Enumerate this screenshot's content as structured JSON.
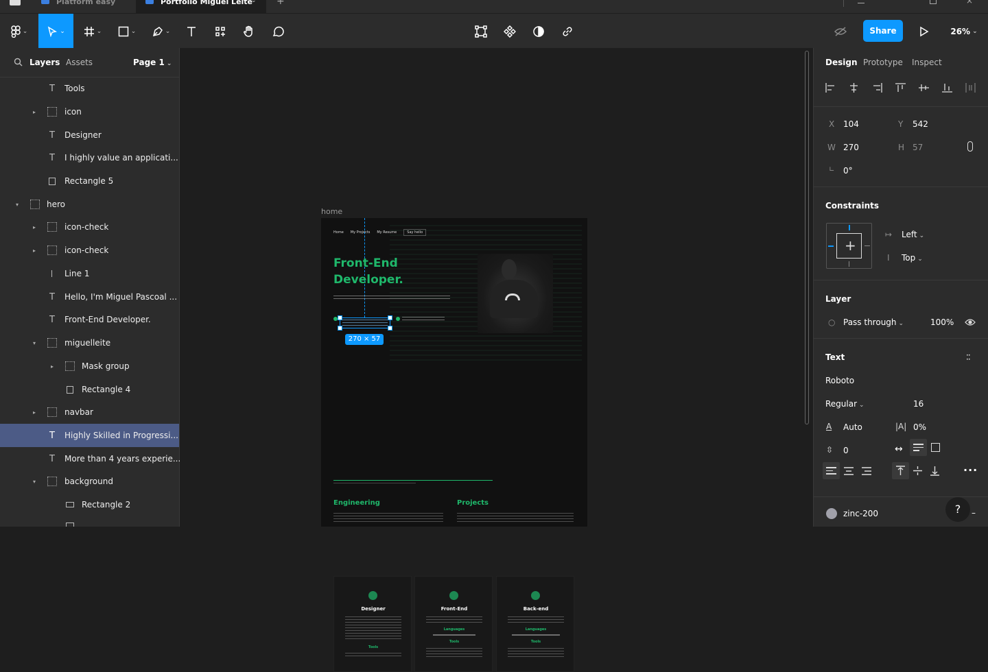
{
  "tabs": [
    {
      "label": "Platform easy",
      "active": false
    },
    {
      "label": "Portfolio Miguel Leite",
      "active": true
    }
  ],
  "toolbar": {
    "share_label": "Share",
    "zoom": "26%"
  },
  "left_panel": {
    "tab_layers": "Layers",
    "tab_assets": "Assets",
    "page": "Page 1",
    "layers": [
      {
        "label": "Tools",
        "type": "text"
      },
      {
        "label": "icon",
        "type": "frame"
      },
      {
        "label": "Designer",
        "type": "text"
      },
      {
        "label": "I highly value an applicati...",
        "type": "text"
      },
      {
        "label": "Rectangle 5",
        "type": "rect"
      },
      {
        "label": "hero",
        "type": "frame"
      },
      {
        "label": "icon-check",
        "type": "frame"
      },
      {
        "label": "icon-check",
        "type": "frame"
      },
      {
        "label": "Line 1",
        "type": "line"
      },
      {
        "label": "Hello, I'm Miguel Pascoal ...",
        "type": "text"
      },
      {
        "label": "Front-End Developer.",
        "type": "text"
      },
      {
        "label": "miguelleite",
        "type": "frame"
      },
      {
        "label": "Mask group",
        "type": "frame"
      },
      {
        "label": "Rectangle 4",
        "type": "rect"
      },
      {
        "label": "navbar",
        "type": "frame"
      },
      {
        "label": "Highly Skilled in Progressi...",
        "type": "text",
        "selected": true
      },
      {
        "label": "More than 4 years experie...",
        "type": "text"
      },
      {
        "label": "background",
        "type": "frame"
      },
      {
        "label": "Rectangle 2",
        "type": "rect"
      }
    ]
  },
  "canvas": {
    "frame_label": "home",
    "nav": [
      "Home",
      "My Projects",
      "My Resume",
      "Say hello"
    ],
    "hero_title_1": "Front-End",
    "hero_title_2": "Developer.",
    "selection_size": "270 × 57",
    "cards": [
      {
        "title": "Designer",
        "languages_label": "",
        "tools_label": "Tools"
      },
      {
        "title": "Front-End",
        "languages_label": "Languages",
        "tools_label": "Tools"
      },
      {
        "title": "Back-end",
        "languages_label": "Languages",
        "tools_label": "Tools"
      }
    ],
    "section_engineering": "Engineering",
    "section_projects": "Projects"
  },
  "right_panel": {
    "tab_design": "Design",
    "tab_prototype": "Prototype",
    "tab_inspect": "Inspect",
    "x_label": "X",
    "x_value": "104",
    "y_label": "Y",
    "y_value": "542",
    "w_label": "W",
    "w_value": "270",
    "h_label": "H",
    "h_value": "57",
    "rotation": "0°",
    "constraints_title": "Constraints",
    "constraint_h": "Left",
    "constraint_v": "Top",
    "layer_title": "Layer",
    "blend": "Pass through",
    "opacity": "100%",
    "text_title": "Text",
    "font_family": "Roboto",
    "font_weight": "Regular",
    "font_size": "16",
    "line_height": "Auto",
    "letter_spacing": "0%",
    "paragraph_spacing": "0",
    "fill_name": "zinc-200",
    "help": "?"
  },
  "colors": {
    "accent": "#0d99ff",
    "selected_layer": "#4c5b86",
    "brand_green": "#1fb86b"
  }
}
